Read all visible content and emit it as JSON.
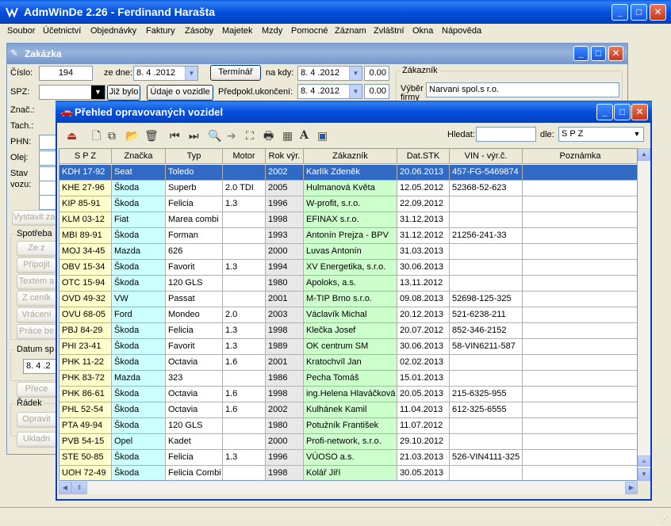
{
  "app": {
    "title": "AdmWinDe 2.26 - Ferdinand Harašta"
  },
  "menu": [
    "Soubor",
    "Účetnictví",
    "Objednávky",
    "Faktury",
    "Zásoby",
    "Majetek",
    "Mzdy",
    "Pomocné",
    "Záznam",
    "Zvláštní",
    "Okna",
    "Nápověda"
  ],
  "zakazka": {
    "title": "Zakázka",
    "cislo_label": "Číslo:",
    "cislo_value": "194",
    "ze_dne_label": "ze dne:",
    "ze_dne_value": "8. 4 .2012",
    "terminar_button": "Termínář",
    "na_kdy_label": "na kdy:",
    "na_kdy_value": "8. 4 .2012",
    "na_kdy_time": "0.00",
    "spz_label": "SPZ:",
    "uz_bylo_button": "Již bylo",
    "udaje_button": "Údaje o vozidle",
    "predpokl_label": "Předpokl.ukončení:",
    "predpokl_value": "8. 4 .2012",
    "predpokl_time": "0.00",
    "zakaznik_group": "Zákazník",
    "vyber_firmy_label": "Výběr firmy",
    "firma_value": "Narvani spol.s r.o.",
    "znac_label": "Znač.:",
    "tach_label": "Tach.:",
    "phn_label": "PHN:",
    "olej_label": "Olej:",
    "stav_vozu_label": "Stav vozu:",
    "vystavit_button": "Vystavit za",
    "spotreba_group": "Spotřeba",
    "side_buttons": [
      "Ze z",
      "Připojit",
      "Textem a",
      "Z ceník",
      "Vrácení",
      "Práce be"
    ],
    "datum_group": "Datum sp",
    "datum_value": "8. 4 .2",
    "prec_button": "Přece",
    "radek_group": "Řádek",
    "opravit_button": "Opravit",
    "ulozit_button": "Ukladn"
  },
  "prehled": {
    "title": "Přehled opravovaných vozidel",
    "hledat_label": "Hledat:",
    "hledat_value": "",
    "dle_label": "dle:",
    "dle_value": "S P Z",
    "columns": [
      "S P Z",
      "Značka",
      "Typ",
      "Motor",
      "Rok výr.",
      "Zákazník",
      "Dat.STK",
      "VIN - výr.č.",
      "Poznámka"
    ],
    "rows": [
      [
        "KDH 17-92",
        "Seat",
        "Toledo",
        "",
        "2002",
        "Karlík Zdeněk",
        "20.06.2013",
        "457-FG-5469874",
        ""
      ],
      [
        "KHE 27-96",
        "Škoda",
        "Superb",
        "2.0 TDI",
        "2005",
        "Hulmanová Květa",
        "12.05.2012",
        "52368-52-623",
        ""
      ],
      [
        "KIP 85-91",
        "Škoda",
        "Felicia",
        "1.3",
        "1996",
        "W-profit, s.r.o.",
        "22.09.2012",
        "",
        ""
      ],
      [
        "KLM 03-12",
        "Fiat",
        "Marea combi",
        "",
        "1998",
        "EFINAX s.r.o.",
        "31.12.2013",
        "",
        ""
      ],
      [
        "MBI 89-91",
        "Škoda",
        "Forman",
        "",
        "1993",
        "Antonín Prejza - BPV",
        "31.12.2012",
        "21256-241-33",
        ""
      ],
      [
        "MOJ 34-45",
        "Mazda",
        "626",
        "",
        "2000",
        "Luvas Antonín",
        "31.03.2013",
        "",
        ""
      ],
      [
        "OBV 15-34",
        "Škoda",
        "Favorit",
        "1.3",
        "1994",
        "XV Energetika, s.r.o.",
        "30.06.2013",
        "",
        ""
      ],
      [
        "OTC 15-94",
        "Škoda",
        "120 GLS",
        "",
        "1980",
        "Apoloks, a.s.",
        "13.11.2012",
        "",
        ""
      ],
      [
        "OVD 49-32",
        "VW",
        "Passat",
        "",
        "2001",
        "M-TIP Brno s.r.o.",
        "09.08.2013",
        "52698-125-325",
        ""
      ],
      [
        "OVU 68-05",
        "Ford",
        "Mondeo",
        "2.0",
        "2003",
        "Václavík Michal",
        "20.12.2013",
        "521-6238-211",
        ""
      ],
      [
        "PBJ 84-29",
        "Škoda",
        "Felicia",
        "1.3",
        "1998",
        "Klečka Josef",
        "20.07.2012",
        "852-346-2152",
        ""
      ],
      [
        "PHI 23-41",
        "Škoda",
        "Favorit",
        "1.3",
        "1989",
        "OK centrum SM",
        "30.06.2013",
        "58-VIN6211-587",
        ""
      ],
      [
        "PHK 11-22",
        "Škoda",
        "Octavia",
        "1.6",
        "2001",
        "Kratochvíl Jan",
        "02.02.2013",
        "",
        ""
      ],
      [
        "PHK 83-72",
        "Mazda",
        "323",
        "",
        "1986",
        "Pecha Tomáš",
        "15.01.2013",
        "",
        ""
      ],
      [
        "PHK 86-61",
        "Škoda",
        "Octavia",
        "1.6",
        "1998",
        "ing.Helena Hlaváčková",
        "20.05.2013",
        "215-6325-955",
        ""
      ],
      [
        "PHL 52-54",
        "Škoda",
        "Octavia",
        "1.6",
        "2002",
        "Kulhánek Kamil",
        "11.04.2013",
        "612-325-6555",
        ""
      ],
      [
        "PTA 49-94",
        "Škoda",
        "120 GLS",
        "",
        "1980",
        "Potužník František",
        "11.07.2012",
        "",
        ""
      ],
      [
        "PVB 54-15",
        "Opel",
        "Kadet",
        "",
        "2000",
        "Profi-network, s.r.o.",
        "29.10.2012",
        "",
        ""
      ],
      [
        "STE 50-85",
        "Škoda",
        "Felicia",
        "1.3",
        "1996",
        "VÚOSO a.s.",
        "21.03.2013",
        "526-VIN4111-325",
        ""
      ],
      [
        "UOH 72-49",
        "Škoda",
        "Felicia Combi",
        "",
        "1998",
        "Kolář Jiří",
        "30.05.2013",
        "",
        ""
      ]
    ]
  }
}
